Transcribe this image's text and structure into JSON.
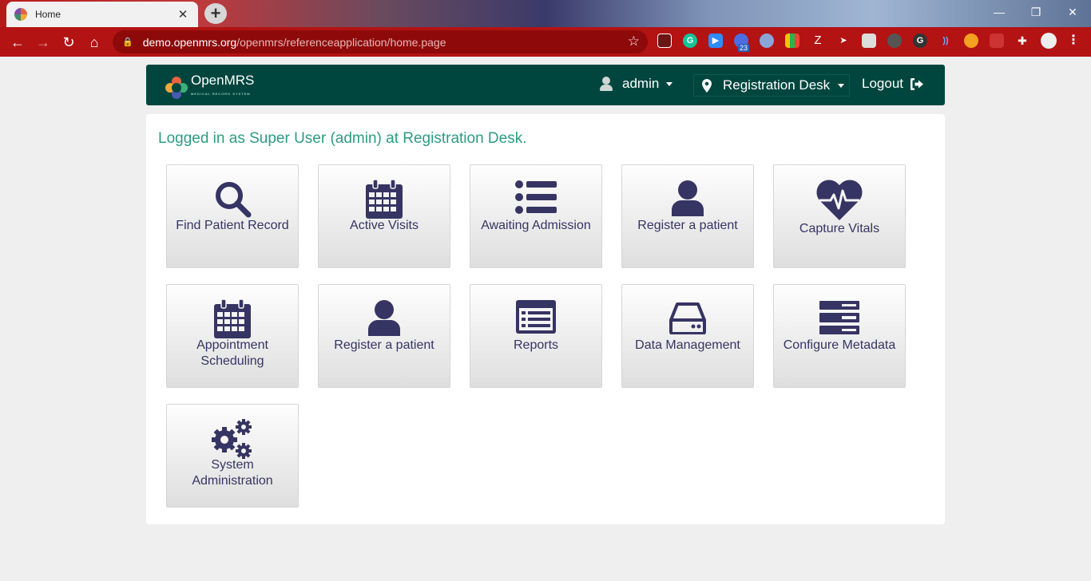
{
  "browser": {
    "tab_title": "Home",
    "tab_close": "✕",
    "new_tab": "+",
    "url_domain": "demo.openmrs.org",
    "url_path": "/openmrs/referenceapplication/home.page",
    "ext_badge": "23",
    "window_controls": [
      "—",
      "❐",
      "✕"
    ]
  },
  "header": {
    "logo_text": "OpenMRS",
    "logo_subtitle": "MEDICAL RECORD SYSTEM",
    "user": "admin",
    "location": "Registration Desk",
    "logout": "Logout"
  },
  "main": {
    "login_message": "Logged in as Super User (admin) at Registration Desk.",
    "apps": [
      {
        "label": "Find Patient Record",
        "icon": "search-icon"
      },
      {
        "label": "Active Visits",
        "icon": "calendar-icon"
      },
      {
        "label": "Awaiting Admission",
        "icon": "list-icon"
      },
      {
        "label": "Register a patient",
        "icon": "user-icon"
      },
      {
        "label": "Capture Vitals",
        "icon": "heartbeat-icon"
      },
      {
        "label": "Appointment Scheduling",
        "icon": "calendar-icon"
      },
      {
        "label": "Register a patient",
        "icon": "user-icon"
      },
      {
        "label": "Reports",
        "icon": "report-icon"
      },
      {
        "label": "Data Management",
        "icon": "hard-drive-icon"
      },
      {
        "label": "Configure Metadata",
        "icon": "server-icon"
      },
      {
        "label": "System Administration",
        "icon": "gears-icon"
      }
    ]
  },
  "colors": {
    "header_bg": "#00463f",
    "accent_text": "#2d9b82",
    "tile_icon": "#363463",
    "browser_toolbar": "#b31313"
  }
}
